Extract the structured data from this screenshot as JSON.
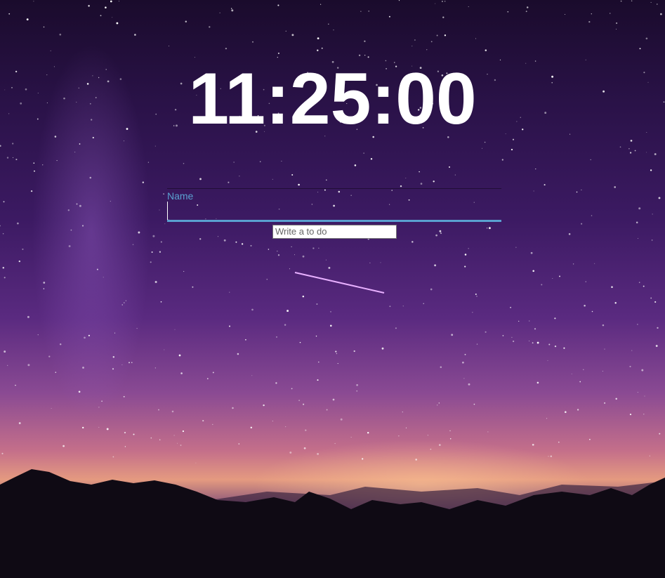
{
  "clock": {
    "time": "11:25:00"
  },
  "name_field": {
    "label": "Name",
    "value": ""
  },
  "todo_input": {
    "placeholder": "Write a to do",
    "value": ""
  },
  "colors": {
    "accent": "#5aa0d0",
    "sky_top": "#1a0b2c",
    "horizon": "#e49a80"
  }
}
